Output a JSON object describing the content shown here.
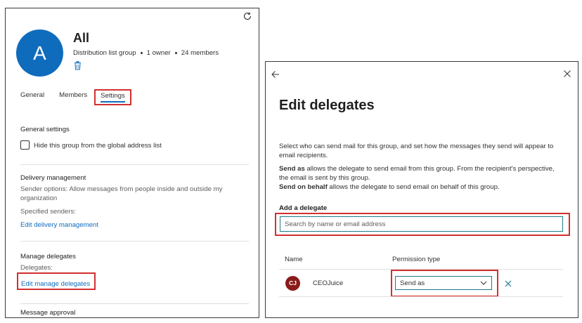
{
  "left": {
    "avatar_letter": "A",
    "title": "All",
    "meta": {
      "type": "Distribution list group",
      "owners": "1 owner",
      "members": "24 members"
    },
    "tabs": {
      "general": "General",
      "members": "Members",
      "settings": "Settings"
    },
    "general_settings": {
      "title": "General settings",
      "hide_label": "Hide this group from the global address list"
    },
    "delivery": {
      "title": "Delivery management",
      "sender_options": "Sender options: Allow messages from people inside and outside my organization",
      "specified_senders": "Specified senders:",
      "edit_link": "Edit delivery management"
    },
    "delegates": {
      "title": "Manage delegates",
      "label": "Delegates:",
      "edit_link": "Edit manage delegates"
    },
    "approval": {
      "title": "Message approval"
    }
  },
  "right": {
    "title": "Edit delegates",
    "intro": "Select who can send mail for this group, and set how the messages they send will appear to email recipients.",
    "send_as": {
      "term": "Send as",
      "text": " allows the delegate to send email from this group. From the recipient's perspective, the email is sent by this group."
    },
    "send_on_behalf": {
      "term": "Send on behalf",
      "text": " allows the delegate to send email on behalf of this group."
    },
    "add_label": "Add a delegate",
    "search_placeholder": "Search by name or email address",
    "columns": {
      "name": "Name",
      "permission": "Permission type"
    },
    "delegate": {
      "initials": "CJ",
      "name": "CEOJuice",
      "permission": "Send as"
    }
  },
  "colors": {
    "accent": "#0f6cbd",
    "highlight": "#d32f2f",
    "avatar_group": "#0f6cbd",
    "avatar_delegate": "#8b1a1a"
  },
  "icons": [
    "refresh-icon",
    "trash-icon",
    "back-arrow-icon",
    "close-icon",
    "chevron-down-icon",
    "remove-icon"
  ]
}
